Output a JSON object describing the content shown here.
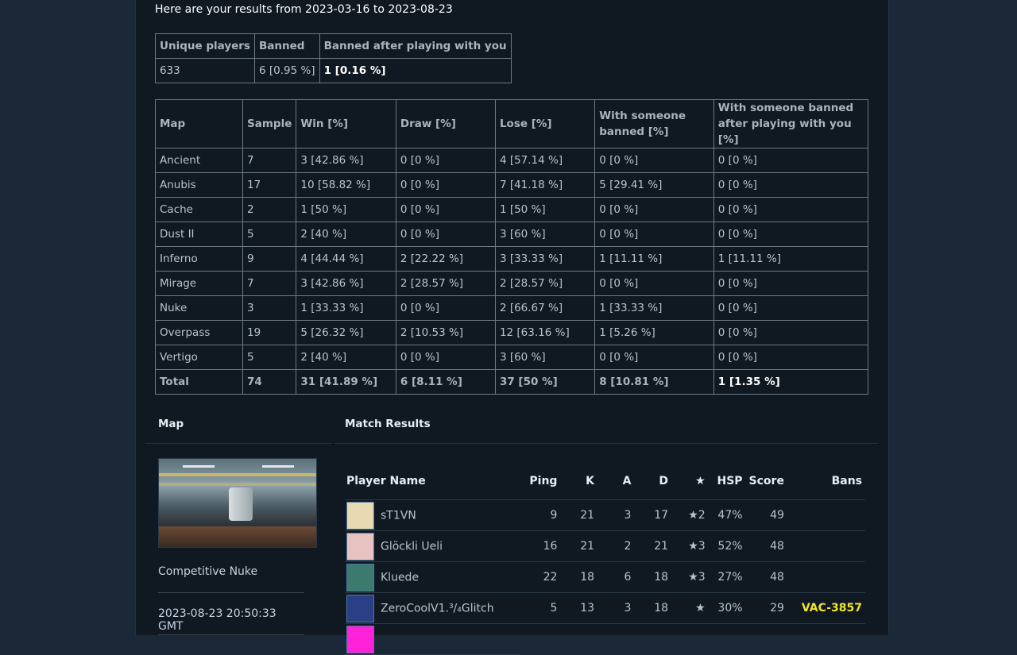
{
  "intro": "Here are your results from 2023-03-16 to 2023-08-23",
  "summary": {
    "headers": [
      "Unique players",
      "Banned",
      "Banned after playing with you"
    ],
    "values": [
      "633",
      "6 [0.95 %]",
      "1 [0.16 %]"
    ]
  },
  "maps": {
    "headers": [
      "Map",
      "Sample",
      "Win [%]",
      "Draw [%]",
      "Lose [%]",
      "With someone banned [%]",
      "With someone banned after playing with you [%]"
    ],
    "rows": [
      [
        "Ancient",
        "7",
        "3 [42.86 %]",
        "0 [0 %]",
        "4 [57.14 %]",
        "0 [0 %]",
        "0 [0 %]"
      ],
      [
        "Anubis",
        "17",
        "10 [58.82 %]",
        "0 [0 %]",
        "7 [41.18 %]",
        "5 [29.41 %]",
        "0 [0 %]"
      ],
      [
        "Cache",
        "2",
        "1 [50 %]",
        "0 [0 %]",
        "1 [50 %]",
        "0 [0 %]",
        "0 [0 %]"
      ],
      [
        "Dust II",
        "5",
        "2 [40 %]",
        "0 [0 %]",
        "3 [60 %]",
        "0 [0 %]",
        "0 [0 %]"
      ],
      [
        "Inferno",
        "9",
        "4 [44.44 %]",
        "2 [22.22 %]",
        "3 [33.33 %]",
        "1 [11.11 %]",
        "1 [11.11 %]"
      ],
      [
        "Mirage",
        "7",
        "3 [42.86 %]",
        "2 [28.57 %]",
        "2 [28.57 %]",
        "0 [0 %]",
        "0 [0 %]"
      ],
      [
        "Nuke",
        "3",
        "1 [33.33 %]",
        "0 [0 %]",
        "2 [66.67 %]",
        "1 [33.33 %]",
        "0 [0 %]"
      ],
      [
        "Overpass",
        "19",
        "5 [26.32 %]",
        "2 [10.53 %]",
        "12 [63.16 %]",
        "1 [5.26 %]",
        "0 [0 %]"
      ],
      [
        "Vertigo",
        "5",
        "2 [40 %]",
        "0 [0 %]",
        "3 [60 %]",
        "0 [0 %]",
        "0 [0 %]"
      ]
    ],
    "total": [
      "Total",
      "74",
      "31 [41.89 %]",
      "6 [8.11 %]",
      "37 [50 %]",
      "8 [10.81 %]",
      "1 [1.35 %]"
    ]
  },
  "map_section": {
    "heading": "Map",
    "mode": "Competitive Nuke",
    "date": "2023-08-23 20:50:33 GMT"
  },
  "match": {
    "heading": "Match Results",
    "headers": [
      "Player Name",
      "Ping",
      "K",
      "A",
      "D",
      "★",
      "HSP",
      "Score",
      "Bans"
    ],
    "players": [
      {
        "name": "sT1VN",
        "ping": "9",
        "k": "21",
        "a": "3",
        "d": "17",
        "mvp": "★2",
        "hsp": "47%",
        "score": "49",
        "bans": "",
        "avatar_color": "#e8d9b0"
      },
      {
        "name": "Glöckli Ueli",
        "ping": "16",
        "k": "21",
        "a": "2",
        "d": "21",
        "mvp": "★3",
        "hsp": "52%",
        "score": "48",
        "bans": "",
        "avatar_color": "#e8c2c0"
      },
      {
        "name": "Kluede",
        "ping": "22",
        "k": "18",
        "a": "6",
        "d": "18",
        "mvp": "★3",
        "hsp": "27%",
        "score": "48",
        "bans": "",
        "avatar_color": "#3c7a6e"
      },
      {
        "name": "ZeroCoolV1.³/₄Glitch",
        "ping": "5",
        "k": "13",
        "a": "3",
        "d": "18",
        "mvp": "★",
        "hsp": "30%",
        "score": "29",
        "bans": "VAC-3857",
        "avatar_color": "#2a3f86"
      }
    ],
    "partial_avatar_color": "#ff22d8"
  }
}
